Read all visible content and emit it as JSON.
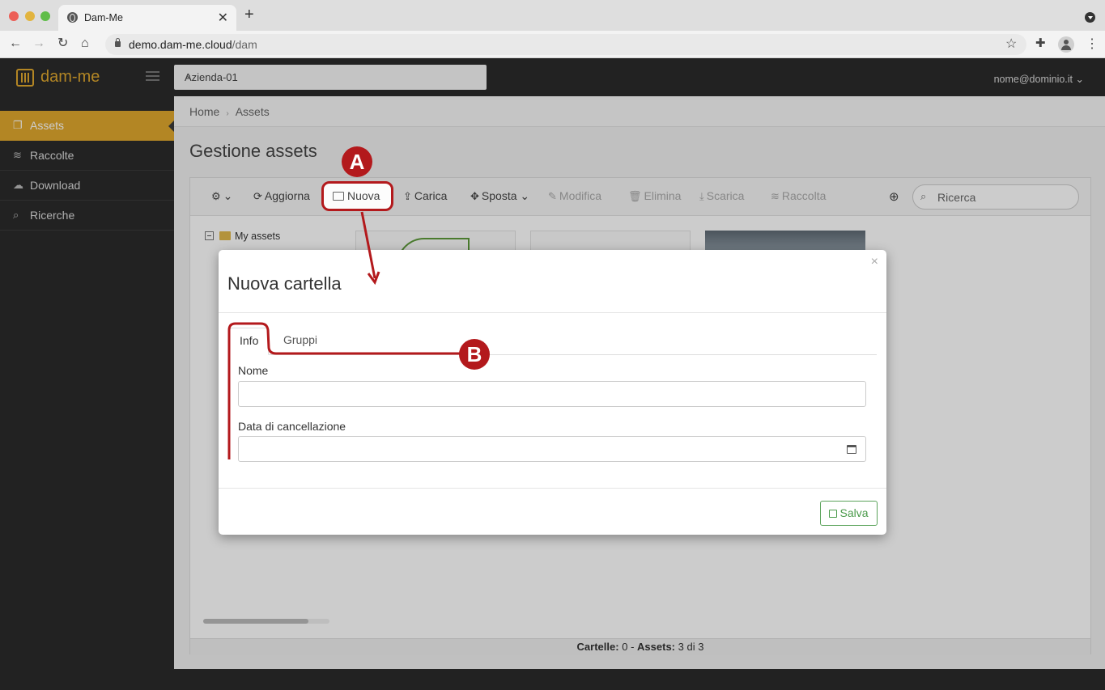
{
  "browser": {
    "tab_title": "Dam-Me",
    "tab_close": "✕",
    "new_tab": "+",
    "url_host": "demo.dam-me.cloud",
    "url_path": "/dam"
  },
  "header": {
    "logo": "dam-me",
    "company": "Azienda-01",
    "user": "nome@dominio.it"
  },
  "sidebar": {
    "items": [
      {
        "label": "Assets",
        "icon": "file-icon",
        "active": true
      },
      {
        "label": "Raccolte",
        "icon": "layers-icon"
      },
      {
        "label": "Download",
        "icon": "cloud-download-icon"
      },
      {
        "label": "Ricerche",
        "icon": "search-icon"
      }
    ]
  },
  "breadcrumb": [
    "Home",
    "Assets"
  ],
  "page_title": "Gestione assets",
  "toolbar": {
    "aggiorna": "Aggiorna",
    "nuova": "Nuova",
    "carica": "Carica",
    "sposta": "Sposta",
    "modifica": "Modifica",
    "elimina": "Elimina",
    "scarica": "Scarica",
    "raccolta": "Raccolta",
    "search_placeholder": "Ricerca"
  },
  "tree": {
    "root": "My assets"
  },
  "status": {
    "folders_label": "Cartelle:",
    "folders_value": "0",
    "sep": "-",
    "assets_label": "Assets:",
    "assets_value": "3 di 3"
  },
  "modal": {
    "title": "Nuova cartella",
    "close": "×",
    "tabs": [
      "Info",
      "Gruppi"
    ],
    "name_label": "Nome",
    "date_label": "Data di cancellazione",
    "save": "Salva"
  },
  "annotations": {
    "a": "A",
    "b": "B",
    "color": "#b3191c"
  },
  "colors": {
    "accent": "#e0a82e",
    "dark": "#2b2b2b",
    "success": "#4a9a4a"
  }
}
